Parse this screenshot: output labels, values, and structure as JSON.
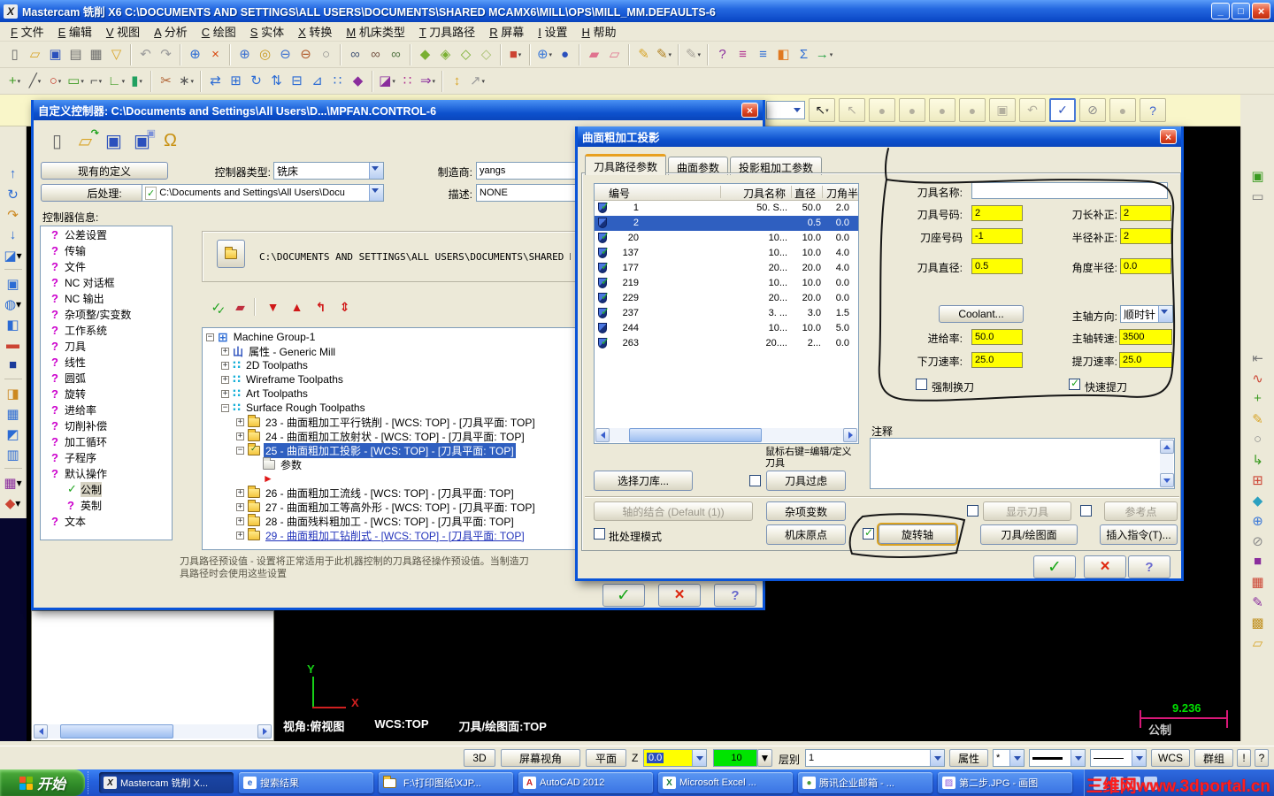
{
  "window": {
    "title": "Mastercam 铣削 X6   C:\\DOCUMENTS AND SETTINGS\\ALL USERS\\DOCUMENTS\\SHARED MCAMX6\\MILL\\OPS\\MILL_MM.DEFAULTS-6",
    "app_initial": "X",
    "minimize": "_",
    "restore": "□",
    "close": "×"
  },
  "buttons": {
    "ok": "✓",
    "cancel": "×",
    "help": "?"
  },
  "menu": {
    "items": [
      {
        "key": "F",
        "label": "文件"
      },
      {
        "key": "E",
        "label": "编辑"
      },
      {
        "key": "V",
        "label": "视图"
      },
      {
        "key": "A",
        "label": "分析"
      },
      {
        "key": "C",
        "label": "绘图"
      },
      {
        "key": "S",
        "label": "实体"
      },
      {
        "key": "X",
        "label": "转换"
      },
      {
        "key": "M",
        "label": "机床类型"
      },
      {
        "key": "T",
        "label": "刀具路径"
      },
      {
        "key": "R",
        "label": "屏幕"
      },
      {
        "key": "I",
        "label": "设置"
      },
      {
        "key": "H",
        "label": "帮助"
      }
    ]
  },
  "toolbar_row1": [
    {
      "n": "new-file",
      "g": "▯",
      "c": "#666"
    },
    {
      "n": "open-file",
      "g": "▱",
      "c": "#d8a427"
    },
    {
      "n": "save-file",
      "g": "▣",
      "c": "#2b50bd"
    },
    {
      "n": "print",
      "g": "▤",
      "c": "#6a6a6a"
    },
    {
      "n": "print-preview",
      "g": "▦",
      "c": "#6a6a6a"
    },
    {
      "n": "filter-funnel",
      "g": "▽",
      "c": "#d8a427"
    },
    "|",
    {
      "n": "undo",
      "g": "↶",
      "c": "#9a9a9a"
    },
    {
      "n": "redo",
      "g": "↷",
      "c": "#9a9a9a"
    },
    "|",
    {
      "n": "pan-crosshair",
      "g": "⊕",
      "c": "#2b6bd4"
    },
    {
      "n": "delete-entity",
      "g": "×",
      "c": "#d8480f"
    },
    "|",
    {
      "n": "zoom-window",
      "g": "⊕",
      "c": "#3a6fd0"
    },
    {
      "n": "zoom-target",
      "g": "◎",
      "c": "#c8981d"
    },
    {
      "n": "zoom-out",
      "g": "⊖",
      "c": "#3a6fd0"
    },
    {
      "n": "zoom-previous",
      "g": "⊖",
      "c": "#b05a2a"
    },
    {
      "n": "zoom-fit",
      "g": "○",
      "c": "#888"
    },
    "|",
    {
      "n": "analyze-entity",
      "g": "∞",
      "c": "#4a5a7a"
    },
    {
      "n": "analyze-dynamic",
      "g": "∞",
      "c": "#7a5a4a"
    },
    {
      "n": "analyze-angle",
      "g": "∞",
      "c": "#5a7a4a"
    },
    "|",
    {
      "n": "shade-solid",
      "g": "◆",
      "c": "#7ab032"
    },
    {
      "n": "shade-translucent",
      "g": "◈",
      "c": "#7ab032"
    },
    {
      "n": "shade-wire",
      "g": "◇",
      "c": "#7ab032"
    },
    {
      "n": "shade-off",
      "g": "◇",
      "c": "#a8c070"
    },
    "|",
    {
      "n": "view-cube",
      "g": "■",
      "c": "#cc4433",
      "k": 1
    },
    "|",
    {
      "n": "gview-globe",
      "g": "⊕",
      "c": "#3a78d8",
      "k": 1
    },
    {
      "n": "gview-sphere",
      "g": "●",
      "c": "#2b50bd"
    },
    "|",
    {
      "n": "solid-chamfer",
      "g": "▰",
      "c": "#e0738f"
    },
    {
      "n": "solid-shell",
      "g": "▱",
      "c": "#e0738f"
    },
    "|",
    {
      "n": "edit-pencil",
      "g": "✎",
      "c": "#d8a427"
    },
    {
      "n": "edit-multi",
      "g": "✎",
      "c": "#b08020",
      "k": 1
    },
    "|",
    {
      "n": "edit-gray",
      "g": "✎",
      "c": "#a8a49a",
      "k": 1
    },
    "|",
    {
      "n": "analyze-check",
      "g": "?",
      "c": "#8a2d9d"
    },
    {
      "n": "hist-magenta",
      "g": "≡",
      "c": "#b03090"
    },
    {
      "n": "hist-blue",
      "g": "≡",
      "c": "#2b6bd4"
    },
    {
      "n": "volume-box",
      "g": "◧",
      "c": "#e07820"
    },
    {
      "n": "sigma",
      "g": "Σ",
      "c": "#2b6bd4"
    },
    {
      "n": "exit-app",
      "g": "→",
      "c": "#20a040",
      "k": 1
    }
  ],
  "toolbar_row2": [
    {
      "n": "create-point",
      "g": "+",
      "c": "#3a9a20",
      "k": 1
    },
    {
      "n": "create-line",
      "g": "╱",
      "c": "#555",
      "k": 1
    },
    {
      "n": "create-arc",
      "g": "○",
      "c": "#c03020",
      "k": 1
    },
    {
      "n": "create-rect",
      "g": "▭",
      "c": "#3a9a20",
      "k": 1
    },
    {
      "n": "create-fillet",
      "g": "⌐",
      "c": "#555",
      "k": 1
    },
    {
      "n": "create-polyline",
      "g": "∟",
      "c": "#3a9a20",
      "k": 1
    },
    {
      "n": "create-cylinder",
      "g": "▮",
      "c": "#20a060",
      "k": 1
    },
    "|",
    {
      "n": "trim-break",
      "g": "✂",
      "c": "#b06030"
    },
    {
      "n": "trim-divide",
      "g": "∗",
      "c": "#555",
      "k": 1
    },
    "|",
    {
      "n": "xform-translate",
      "g": "⇄",
      "c": "#2b6bd4"
    },
    {
      "n": "xform-copy",
      "g": "⊞",
      "c": "#2b6bd4"
    },
    {
      "n": "xform-rotate",
      "g": "↻",
      "c": "#2b6bd4"
    },
    {
      "n": "xform-mirror",
      "g": "⇅",
      "c": "#2b6bd4"
    },
    {
      "n": "xform-offset",
      "g": "⊟",
      "c": "#2b6bd4"
    },
    {
      "n": "xform-stretch",
      "g": "⊿",
      "c": "#2b6bd4"
    },
    {
      "n": "xform-array",
      "g": "∷",
      "c": "#2b6bd4"
    },
    {
      "n": "xform-solid",
      "g": "◆",
      "c": "#8a2d9d"
    },
    "|",
    {
      "n": "level-manager",
      "g": "◪",
      "c": "#8a2d9d",
      "k": 1
    },
    {
      "n": "grid-settings",
      "g": "∷",
      "c": "#b03090"
    },
    {
      "n": "expand-ribbon",
      "g": "⇒",
      "c": "#8a2d9d",
      "k": 1
    },
    "|",
    {
      "n": "highlight-bulb",
      "g": "↕",
      "c": "#d8a427"
    },
    {
      "n": "measure-arrow",
      "g": "↗",
      "c": "#9a9a9a",
      "k": 1
    }
  ],
  "left_toolbar": [
    {
      "n": "gview-top",
      "g": "↑",
      "c": "#2b6bd4"
    },
    {
      "n": "gview-rotate",
      "g": "↻",
      "c": "#2b6bd4"
    },
    {
      "n": "gview-back",
      "g": "↷",
      "c": "#cc8820"
    },
    {
      "n": "gview-bottom",
      "g": "↓",
      "c": "#2b6bd4"
    },
    {
      "n": "gview-iso",
      "g": "◪",
      "c": "#2b6bd4",
      "k": 1
    },
    "|",
    {
      "n": "view-fit",
      "g": "▣",
      "c": "#2b6bd4"
    },
    {
      "n": "view-sphere",
      "g": "◍",
      "c": "#2b6bd4",
      "k": 1
    },
    {
      "n": "view-front",
      "g": "◧",
      "c": "#2b6bd4"
    },
    {
      "n": "view-slice",
      "g": "▬",
      "c": "#cc4433"
    },
    {
      "n": "view-cube-blue",
      "g": "■",
      "c": "#1a3a9a"
    },
    "|",
    {
      "n": "vp-orange",
      "g": "◨",
      "c": "#cc8820"
    },
    {
      "n": "vp-grid",
      "g": "▦",
      "c": "#2b6bd4"
    },
    {
      "n": "vp-rotate",
      "g": "◩",
      "c": "#2b6bd4"
    },
    {
      "n": "vp-named",
      "g": "▥",
      "c": "#2b6bd4"
    },
    "|",
    {
      "n": "vp-multi",
      "g": "▦",
      "c": "#8a2d9d",
      "k": 1
    },
    {
      "n": "vp-dynamic",
      "g": "◆",
      "c": "#cc4433",
      "k": 1
    }
  ],
  "right_toolbar": [
    {
      "n": "machine-sim",
      "g": "▣",
      "c": "#3a9a20"
    },
    {
      "n": "machine-def",
      "g": "▭",
      "c": "#7a7a7a"
    },
    "gap",
    {
      "n": "util-extend",
      "g": "⇤",
      "c": "#7a7a7a"
    },
    {
      "n": "util-curve",
      "g": "∿",
      "c": "#cc4433"
    },
    {
      "n": "util-plus",
      "g": "+",
      "c": "#3a9a20"
    },
    {
      "n": "util-pencil",
      "g": "✎",
      "c": "#d8a427"
    },
    {
      "n": "util-circle",
      "g": "○",
      "c": "#8a8a8a"
    },
    {
      "n": "util-path",
      "g": "↳",
      "c": "#3a9a20"
    },
    {
      "n": "util-grid-red",
      "g": "⊞",
      "c": "#cc4433"
    },
    {
      "n": "util-surface",
      "g": "◆",
      "c": "#2ba0c0"
    },
    {
      "n": "util-globe",
      "g": "⊕",
      "c": "#3a78d8"
    },
    {
      "n": "util-none",
      "g": "⊘",
      "c": "#8a8a8a"
    },
    {
      "n": "util-purple",
      "g": "■",
      "c": "#8a2d9d"
    },
    {
      "n": "util-grid2",
      "g": "▦",
      "c": "#cc4433"
    },
    {
      "n": "util-pencil2",
      "g": "✎",
      "c": "#8a2d9d"
    },
    {
      "n": "util-colors",
      "g": "▩",
      "c": "#c09020"
    },
    {
      "n": "util-folder",
      "g": "▱",
      "c": "#d8a427"
    }
  ],
  "ribbon": {
    "items": [
      {
        "n": "auto-cursor-combo",
        "t": "combo"
      },
      {
        "n": "select-arrow-button",
        "g": "↖",
        "c": "#222",
        "k": 1
      },
      {
        "n": "select-all-disabled",
        "g": "↖",
        "c": "#b3af9e",
        "d": 1
      },
      {
        "n": "select-blob-1",
        "g": "●",
        "c": "#b3af9e",
        "d": 1
      },
      {
        "n": "select-blob-2",
        "g": "●",
        "c": "#b3af9e",
        "d": 1
      },
      {
        "n": "select-blob-3",
        "g": "●",
        "c": "#b3af9e",
        "d": 1
      },
      {
        "n": "select-blob-4",
        "g": "●",
        "c": "#b3af9e",
        "d": 1
      },
      {
        "n": "select-solid",
        "g": "▣",
        "c": "#b3af9e",
        "d": 1
      },
      {
        "n": "select-undo",
        "g": "↶",
        "c": "#b3af9e",
        "d": 1
      },
      {
        "n": "select-end",
        "g": "✓",
        "c": "#2b50bd",
        "s": 1
      },
      {
        "n": "select-none",
        "g": "⊘",
        "c": "#8a8a8a"
      },
      {
        "n": "select-circle",
        "g": "●",
        "c": "#b3af9e"
      },
      {
        "n": "ribbon-help",
        "g": "?",
        "c": "#3a5fcd"
      }
    ]
  },
  "controller_dialog": {
    "title": "自定义控制器: C:\\Documents and Settings\\All Users\\D...\\MPFAN.CONTROL-6",
    "existing": "现有的定义",
    "post": "后处理:",
    "type_label": "控制器类型:",
    "type_value": "铣床",
    "mfr_label": "制造商:",
    "mfr_value": "yangs",
    "desc_label": "描述:",
    "desc_value": "NONE",
    "post_path": "C:\\Documents and Settings\\All Users\\Docu",
    "info_label": "控制器信息:",
    "shared_path": "C:\\DOCUMENTS AND SETTINGS\\ALL USERS\\DOCUMENTS\\SHARED MCAMX",
    "hint1": "刀具路径预设值 - 设置将正常适用于此机器控制的刀具路径操作预设值。当制造刀",
    "hint2": "具路径时会使用这些设置",
    "file_icons": [
      {
        "n": "controller-new",
        "g": "▯",
        "c": "#666"
      },
      {
        "n": "controller-open",
        "g": "▱",
        "c": "#d8a427",
        "b": "↷",
        "bc": "#18a018"
      },
      {
        "n": "controller-save",
        "g": "▣",
        "c": "#2b50bd"
      },
      {
        "n": "controller-save-as",
        "g": "▣",
        "c": "#2b50bd",
        "b": "▣",
        "bc": "#7a90d8"
      },
      {
        "n": "controller-lock",
        "g": "Ω",
        "c": "#c89010"
      }
    ],
    "mini_icons": [
      {
        "n": "verify-all",
        "g": "✓",
        "c": "#18a018",
        "b": "✓",
        "bc": "#18a018"
      },
      {
        "n": "erase-setting",
        "g": "▰",
        "c": "#c03040"
      },
      "|",
      {
        "n": "move-down",
        "g": "▼",
        "c": "#d01818"
      },
      {
        "n": "move-up",
        "g": "▲",
        "c": "#d01818"
      },
      {
        "n": "reset-loop",
        "g": "↰",
        "c": "#d01818"
      },
      {
        "n": "expand-collapse",
        "g": "⇕",
        "c": "#d01818"
      }
    ],
    "info_tree": [
      {
        "label": "公差设置"
      },
      {
        "label": "传输"
      },
      {
        "label": "文件"
      },
      {
        "label": "NC 对话框"
      },
      {
        "label": "NC 输出"
      },
      {
        "label": "杂项整/实变数"
      },
      {
        "label": "工作系统"
      },
      {
        "label": "刀具"
      },
      {
        "label": "线性"
      },
      {
        "label": "圆弧"
      },
      {
        "label": "旋转"
      },
      {
        "label": "进给率"
      },
      {
        "label": "切削补偿"
      },
      {
        "label": "加工循环"
      },
      {
        "label": "子程序"
      },
      {
        "label": "默认操作"
      },
      {
        "label": "公制",
        "child": true,
        "checked": true,
        "selected": true
      },
      {
        "label": "英制",
        "child": true
      },
      {
        "label": "文本"
      }
    ],
    "machine_tree": [
      {
        "indent": 0,
        "expand": "-",
        "icon": "grid4",
        "label": "Machine Group-1"
      },
      {
        "indent": 1,
        "expand": "+",
        "icon": "props",
        "label": "属性 - Generic Mill"
      },
      {
        "indent": 1,
        "expand": "+",
        "icon": "dots",
        "label": "2D Toolpaths"
      },
      {
        "indent": 1,
        "expand": "+",
        "icon": "dots",
        "label": "Wireframe Toolpaths"
      },
      {
        "indent": 1,
        "expand": "+",
        "icon": "dots",
        "label": "Art Toolpaths"
      },
      {
        "indent": 1,
        "expand": "-",
        "icon": "dots",
        "label": "Surface Rough Toolpaths"
      },
      {
        "indent": 2,
        "expand": "+",
        "icon": "folder",
        "label": "23 - 曲面粗加工平行铣削 - [WCS: TOP] - [刀具平面: TOP]"
      },
      {
        "indent": 2,
        "expand": "+",
        "icon": "folder",
        "label": "24 - 曲面粗加工放射状 - [WCS: TOP] - [刀具平面: TOP]"
      },
      {
        "indent": 2,
        "expand": "-",
        "icon": "folder-open",
        "label": "25 - 曲面粗加工投影 - [WCS: TOP] - [刀具平面: TOP]",
        "selected": true
      },
      {
        "indent": 3,
        "expand": "",
        "icon": "folder-gray",
        "label": "参数"
      },
      {
        "indent": 3,
        "expand": "",
        "icon": "marker",
        "label": ""
      },
      {
        "indent": 2,
        "expand": "+",
        "icon": "folder",
        "label": "26 - 曲面粗加工流线 - [WCS: TOP] - [刀具平面: TOP]"
      },
      {
        "indent": 2,
        "expand": "+",
        "icon": "folder",
        "label": "27 - 曲面粗加工等高外形 - [WCS: TOP] - [刀具平面: TOP]"
      },
      {
        "indent": 2,
        "expand": "+",
        "icon": "folder",
        "label": "28 - 曲面残料粗加工 - [WCS: TOP] - [刀具平面: TOP]"
      },
      {
        "indent": 2,
        "expand": "+",
        "icon": "folder",
        "label": "29 - 曲面粗加工钻削式 - [WCS: TOP] - [刀具平面: TOP]",
        "underline": true
      }
    ]
  },
  "toolpath_dialog": {
    "title": "曲面粗加工投影",
    "tabs": [
      "刀具路径参数",
      "曲面参数",
      "投影粗加工参数"
    ],
    "table": {
      "headers": [
        "编号",
        "刀具名称",
        "直径",
        "刀角半"
      ],
      "rows": [
        {
          "n": "1",
          "name": "50. S...",
          "dia": "50.0",
          "rad": "2.0",
          "ck": true
        },
        {
          "n": "2",
          "name": "",
          "dia": "0.5",
          "rad": "0.0",
          "ck": false,
          "sel": true
        },
        {
          "n": "20",
          "name": "10...",
          "dia": "10.0",
          "rad": "0.0",
          "ck": true
        },
        {
          "n": "137",
          "name": "10...",
          "dia": "10.0",
          "rad": "4.0",
          "ck": true
        },
        {
          "n": "177",
          "name": "20...",
          "dia": "20.0",
          "rad": "4.0",
          "ck": true
        },
        {
          "n": "219",
          "name": "10...",
          "dia": "10.0",
          "rad": "0.0",
          "ck": true
        },
        {
          "n": "229",
          "name": "20...",
          "dia": "20.0",
          "rad": "0.0",
          "ck": true
        },
        {
          "n": "237",
          "name": "3. ...",
          "dia": "3.0",
          "rad": "1.5",
          "ck": true
        },
        {
          "n": "244",
          "name": "10...",
          "dia": "10.0",
          "rad": "5.0",
          "ck": false
        },
        {
          "n": "263",
          "name": "20....",
          "dia": "2...",
          "rad": "0.0",
          "ck": true
        }
      ]
    },
    "hint1": "鼠标右键=编辑/定义",
    "hint2": "刀具",
    "select_lib": "选择刀库...",
    "tool_filter": "刀具过虑",
    "comment_label": "注释",
    "axis_combine": "轴的结合  (Default (1))",
    "misc_values": "杂项变数",
    "machine_origin": "机床原点",
    "rotate_axis": "旋转轴",
    "show_tool": "显示刀具",
    "ref_point": "参考点",
    "tool_plane": "刀具/绘图面",
    "insert_cmd": "插入指令(T)...",
    "batch_mode": "批处理模式",
    "params": {
      "tool_name_label": "刀具名称:",
      "tool_name_value": "",
      "tool_no_label": "刀具号码:",
      "tool_no_value": "2",
      "len_comp_label": "刀长补正:",
      "len_comp_value": "2",
      "holder_no_label": "刀座号码",
      "holder_no_value": "-1",
      "rad_comp_label": "半径补正:",
      "rad_comp_value": "2",
      "tool_dia_label": "刀具直径:",
      "tool_dia_value": "0.5",
      "corner_rad_label": "角度半径:",
      "corner_rad_value": "0.0",
      "coolant": "Coolant...",
      "spindle_dir_label": "主轴方向:",
      "spindle_dir_value": "顺时针",
      "feed_label": "进给率:",
      "feed_value": "50.0",
      "spindle_label": "主轴转速:",
      "spindle_value": "3500",
      "plunge_label": "下刀速率:",
      "plunge_value": "25.0",
      "retract_label": "提刀速率:",
      "retract_value": "25.0",
      "force_change": "强制换刀",
      "rapid_retract": "快速提刀"
    }
  },
  "graphics": {
    "gview": "视角:俯视图",
    "wcs": "WCS:TOP",
    "cplane": "刀具/绘图面:TOP",
    "scale": "9.236",
    "units": "公制",
    "axis_x": "X",
    "axis_y": "Y",
    "scale_color": "#00e000",
    "units_color": "#c8c8c8",
    "ruler_color": "#d81878"
  },
  "statusbar": {
    "threed": "3D",
    "screen_view": "屏幕视角",
    "plane": "平面",
    "z_label": "Z",
    "z_value": "0.0",
    "grid_value": "10",
    "level_label": "层别",
    "level_value": "1",
    "attr": "属性",
    "star": "*",
    "wcs": "WCS",
    "group": "群组",
    "excl": "!",
    "quest": "?"
  },
  "taskbar": {
    "start": "开始",
    "tasks": [
      {
        "label": "Mastercam 铣削 X...",
        "icon": "mastercam",
        "active": true
      },
      {
        "label": "搜索结果",
        "icon": "ie"
      },
      {
        "label": "F:\\打印图纸\\XJP...",
        "icon": "folder"
      },
      {
        "label": "AutoCAD 2012",
        "icon": "autocad"
      },
      {
        "label": "Microsoft Excel ...",
        "icon": "excel"
      },
      {
        "label": "腾讯企业邮箱 - ...",
        "icon": "chrome"
      },
      {
        "label": "第二步.JPG - 画图",
        "icon": "paint"
      }
    ],
    "watermark": "三维网www.3dportal.cn"
  },
  "annotation_color": "#161616"
}
